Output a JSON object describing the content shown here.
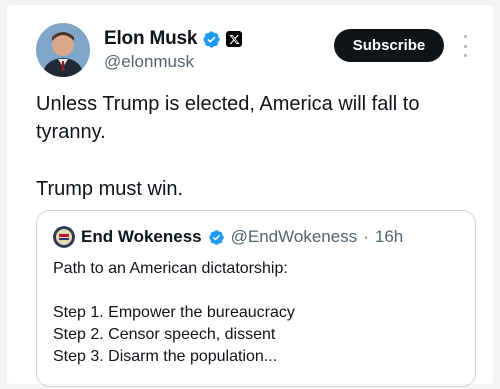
{
  "author": {
    "name": "Elon Musk",
    "handle": "@elonmusk"
  },
  "subscribe_label": "Subscribe",
  "tweet": {
    "line1": "Unless Trump is elected, America will fall to tyranny.",
    "line2": "Trump must win."
  },
  "quoted": {
    "name": "End Wokeness",
    "handle": "@EndWokeness",
    "separator": "·",
    "time": "16h",
    "intro": "Path to an American dictatorship:",
    "steps": [
      "Step 1. Empower the bureaucracy",
      "Step 2. Censor speech, dissent",
      "Step 3. Disarm the population..."
    ]
  },
  "colors": {
    "verified_badge": "#1d9bf0",
    "secondary_text": "#536471",
    "primary_text": "#0f1419"
  }
}
